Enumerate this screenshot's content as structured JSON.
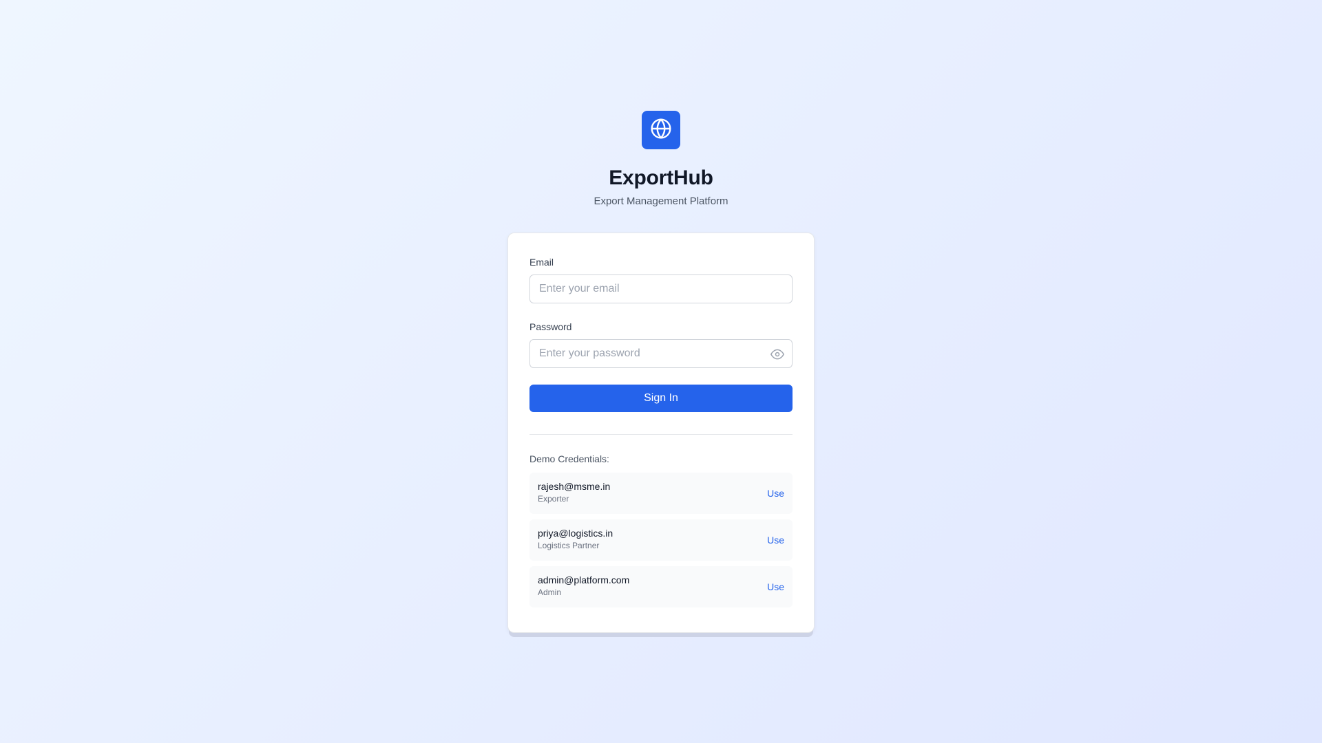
{
  "brand": {
    "title": "ExportHub",
    "subtitle": "Export Management Platform",
    "logo_icon": "globe-icon",
    "accent_color": "#2563eb"
  },
  "form": {
    "email_label": "Email",
    "email_placeholder": "Enter your email",
    "email_value": "",
    "password_label": "Password",
    "password_placeholder": "Enter your password",
    "password_value": "",
    "password_toggle_icon": "eye-icon",
    "submit_label": "Sign In"
  },
  "demo": {
    "title": "Demo Credentials:",
    "credentials": [
      {
        "email": "rajesh@msme.in",
        "role": "Exporter",
        "action": "Use"
      },
      {
        "email": "priya@logistics.in",
        "role": "Logistics Partner",
        "action": "Use"
      },
      {
        "email": "admin@platform.com",
        "role": "Admin",
        "action": "Use"
      }
    ]
  }
}
